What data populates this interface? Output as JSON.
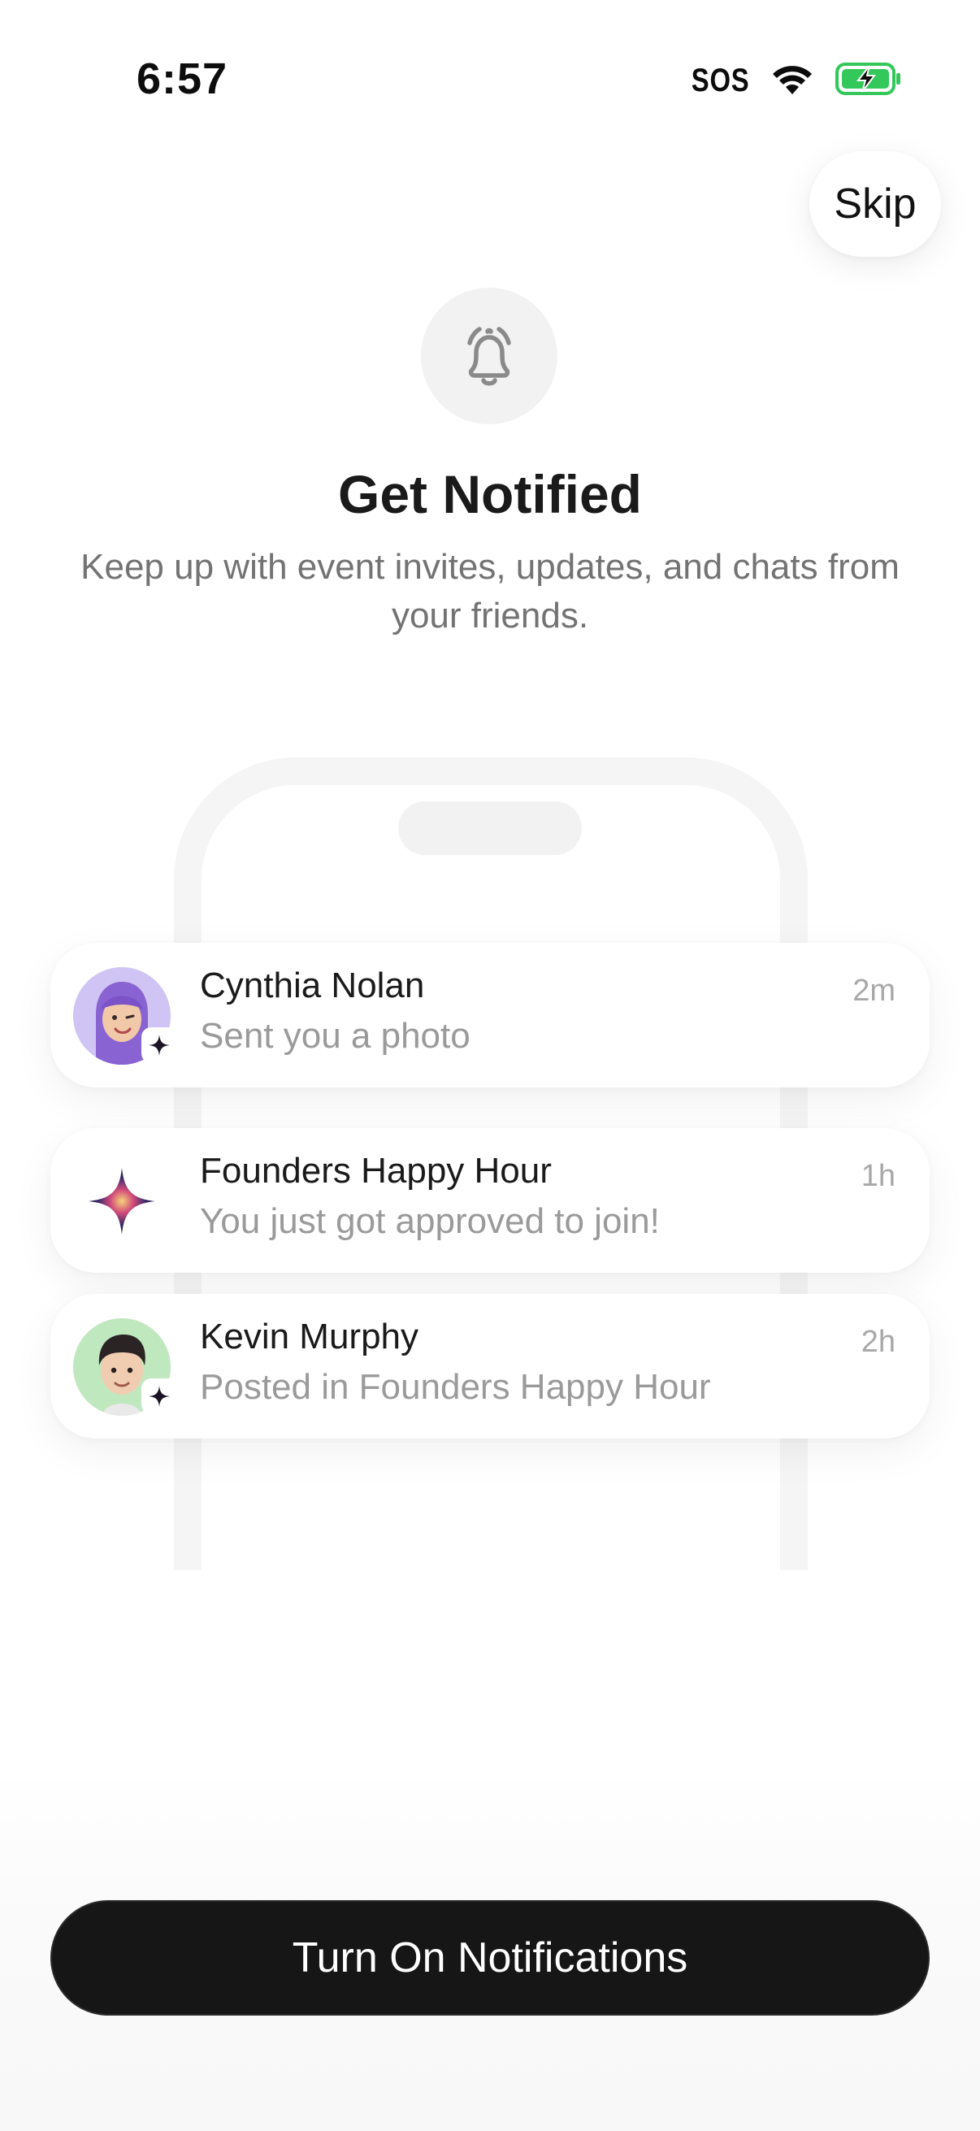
{
  "status_bar": {
    "time": "6:57",
    "sos": "SOS",
    "wifi_icon": "wifi-icon",
    "battery_icon": "battery-charging-icon",
    "battery_color": "#34c759"
  },
  "header": {
    "skip_label": "Skip",
    "bell_icon": "bell-ringing-icon",
    "title": "Get Notified",
    "subtitle": "Keep up with event invites, updates, and chats from your friends."
  },
  "notifications": [
    {
      "name": "Cynthia Nolan",
      "message": "Sent you a photo",
      "time": "2m",
      "avatar": "memoji-purple-hair",
      "avatar_bg": "#cfc4f3"
    },
    {
      "name": "Founders Happy Hour",
      "message": "You just got approved to join!",
      "time": "1h",
      "avatar": "sparkle-icon"
    },
    {
      "name": "Kevin Murphy",
      "message": "Posted in Founders Happy Hour",
      "time": "2h",
      "avatar": "memoji-dark-hair",
      "avatar_bg": "#bfe8bf"
    }
  ],
  "cta": {
    "label": "Turn On Notifications"
  },
  "colors": {
    "cta_bg": "#161616",
    "text_primary": "#1a1a1a",
    "text_secondary": "#737373"
  }
}
